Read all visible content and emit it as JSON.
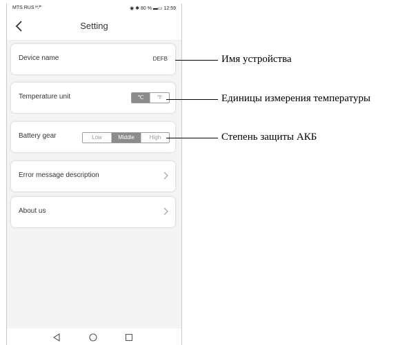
{
  "status_bar": {
    "carrier": "MTS RUS ᴴ.ᴵ‴",
    "right": "◉ ✱ 80 % ▬▭ 12:59"
  },
  "header": {
    "title": "Setting"
  },
  "settings": {
    "device_name": {
      "label": "Device name",
      "value": "DEFB"
    },
    "temperature_unit": {
      "label": "Temperature unit",
      "options": [
        "℃",
        "℉"
      ],
      "selected": "℃"
    },
    "battery_gear": {
      "label": "Battery gear",
      "options": [
        "Low",
        "Middle",
        "High"
      ],
      "selected": "Middle"
    },
    "error_message": {
      "label": "Error message description"
    },
    "about": {
      "label": "About us"
    }
  },
  "callouts": {
    "device_name": "Имя устройства",
    "temperature_unit": "Единицы измерения температуры",
    "battery_gear": "Степень защиты АКБ"
  },
  "icons": {
    "back": "chevron-left-icon",
    "row_arrow": "chevron-right-icon",
    "nav_back": "triangle-back-icon",
    "nav_home": "circle-home-icon",
    "nav_recent": "square-recent-icon"
  }
}
